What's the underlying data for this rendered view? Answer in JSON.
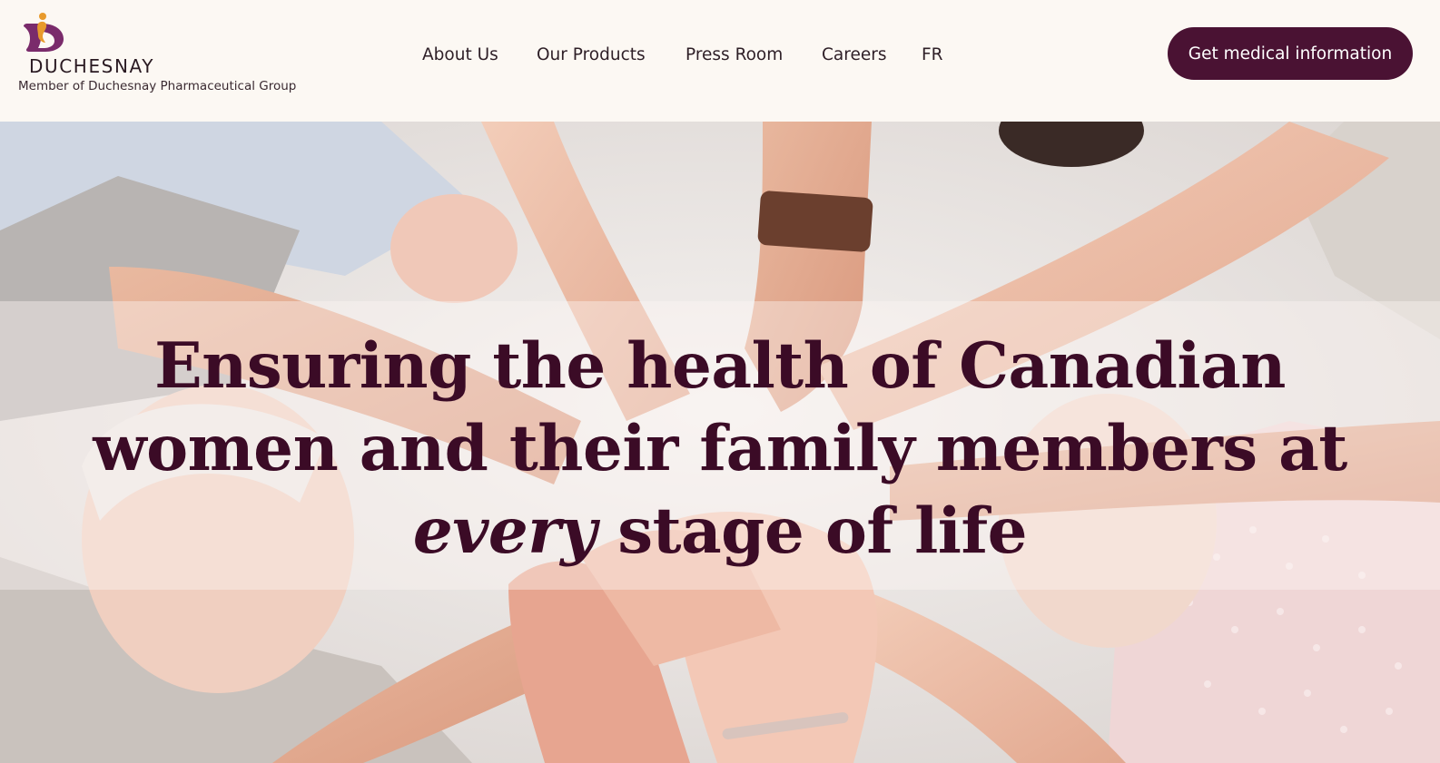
{
  "brand": {
    "name": "DUCHESNAY",
    "tagline": "Member of Duchesnay Pharmaceutical Group",
    "logo_icon": "duchesnay-logo-icon",
    "colors": {
      "primary": "#4a1233",
      "accent_orange": "#e89a2c",
      "accent_purple": "#7a2b6b",
      "background": "#fcf8f3"
    }
  },
  "nav": {
    "items": [
      {
        "label": "About Us"
      },
      {
        "label": "Our Products"
      },
      {
        "label": "Press Room"
      },
      {
        "label": "Careers"
      },
      {
        "label": "FR"
      }
    ]
  },
  "cta": {
    "label": "Get medical information"
  },
  "hero": {
    "line1": "Ensuring the health of Canadian",
    "line2": "women and their family members at",
    "line3_emphasis": "every",
    "line3_rest": " stage of life",
    "image": "group-of-hands-stacked-photo"
  }
}
